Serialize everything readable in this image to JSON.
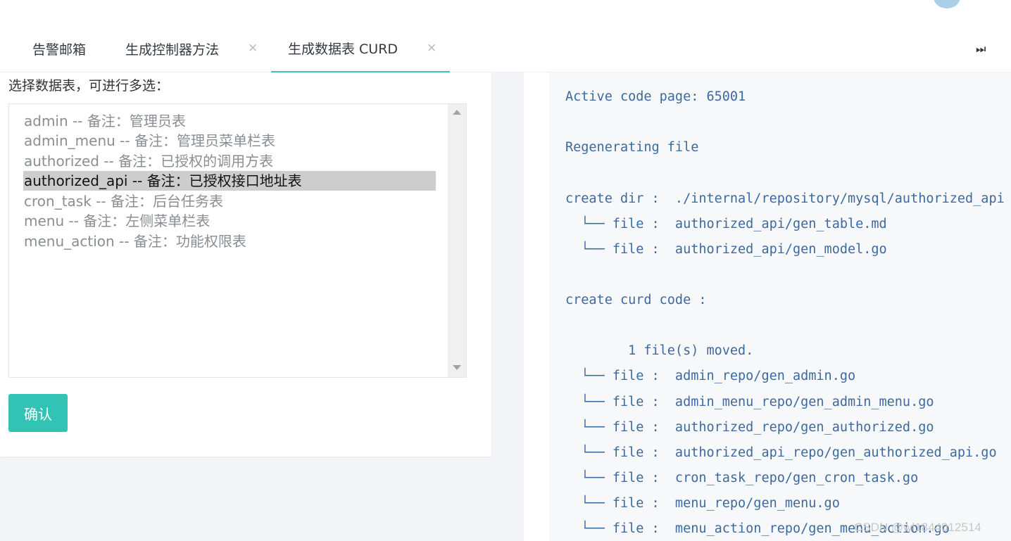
{
  "tabs": [
    {
      "label": "告警邮箱",
      "closable": false
    },
    {
      "label": "生成控制器方法",
      "closable": true
    },
    {
      "label": "生成数据表 CURD",
      "closable": true,
      "active": true
    }
  ],
  "tab_close_glyph": "×",
  "tab_next_glyph": "⏭",
  "select_prompt": "选择数据表，可进行多选：",
  "tables": [
    {
      "label": "admin -- 备注：管理员表",
      "selected": false
    },
    {
      "label": "admin_menu -- 备注：管理员菜单栏表",
      "selected": false
    },
    {
      "label": "authorized -- 备注：已授权的调用方表",
      "selected": false
    },
    {
      "label": "authorized_api -- 备注：已授权接口地址表",
      "selected": true
    },
    {
      "label": "cron_task -- 备注：后台任务表",
      "selected": false
    },
    {
      "label": "menu -- 备注：左侧菜单栏表",
      "selected": false
    },
    {
      "label": "menu_action -- 备注：功能权限表",
      "selected": false
    }
  ],
  "confirm_label": "确认",
  "console_lines": [
    "Active code page: 65001",
    "Regenerating file",
    "create dir :  ./internal/repository/mysql/authorized_api",
    "  └── file :  authorized_api/gen_table.md",
    "  └── file :  authorized_api/gen_model.go",
    "create curd code :",
    "        1 file(s) moved.",
    "  └── file :  admin_repo/gen_admin.go",
    "  └── file :  admin_menu_repo/gen_admin_menu.go",
    "  └── file :  authorized_repo/gen_authorized.go",
    "  └── file :  authorized_api_repo/gen_authorized_api.go",
    "  └── file :  cron_task_repo/gen_cron_task.go",
    "  └── file :  menu_repo/gen_menu.go",
    "  └── file :  menu_action_repo/gen_menu_action.go"
  ],
  "watermark": "CSDN @wl1844012514",
  "colors": {
    "accent": "#33c3b5",
    "console_text": "#3c6aa0",
    "selected_bg": "#cdcdcd"
  }
}
